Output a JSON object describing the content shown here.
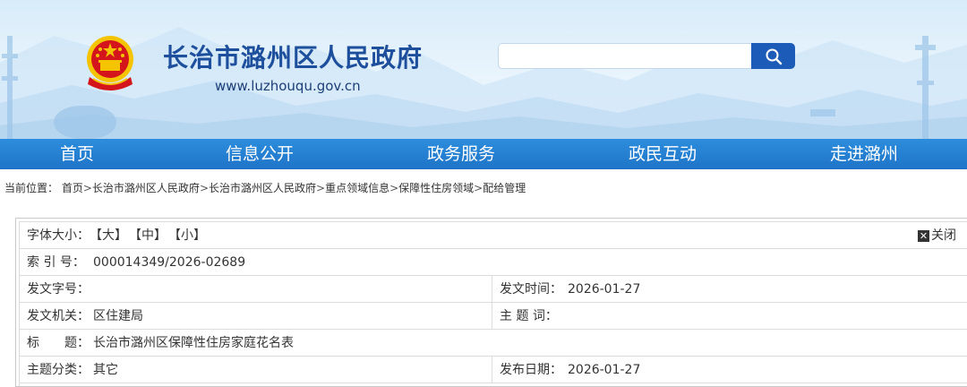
{
  "header": {
    "site_title": "长治市潞州区人民政府",
    "site_url": "www.luzhouqu.gov.cn",
    "search_placeholder": "",
    "search_icon": "magnifier-icon",
    "emblem_icon": "national-emblem-icon"
  },
  "nav": {
    "items": [
      "首页",
      "信息公开",
      "政务服务",
      "政民互动",
      "走进潞州"
    ]
  },
  "breadcrumb": {
    "prefix": "当前位置：",
    "items": [
      "首页",
      "长治市潞州区人民政府",
      "长治市潞州区人民政府",
      "重点领域信息",
      "保障性住房领域",
      "配给管理"
    ],
    "separator": ">"
  },
  "info": {
    "font_size_label": "字体大小：",
    "font_sizes": [
      "【大】",
      "【中】",
      "【小】"
    ],
    "close_label": "关闭",
    "close_icon": "close-icon",
    "index_label": "索 引 号：",
    "index_value": "000014349/2026-02689",
    "doc_no_label": "发文字号：",
    "doc_no_value": "",
    "issue_time_label": "发文时间：",
    "issue_time_value": "2026-01-27",
    "issuer_label": "发文机关：",
    "issuer_value": "区住建局",
    "subject_words_label": "主 题 词：",
    "subject_words_value": "",
    "title_label": "标　　题：",
    "title_value": "长治市潞州区保障性住房家庭花名表",
    "category_label": "主题分类：",
    "category_value": "其它",
    "publish_date_label": "发布日期：",
    "publish_date_value": "2026-01-27"
  },
  "colors": {
    "nav_bg": "#1f74c8",
    "title_blue": "#1d4f9c",
    "search_btn": "#1c5cb8",
    "emblem_red": "#d4161c",
    "emblem_gold": "#f5c400"
  }
}
